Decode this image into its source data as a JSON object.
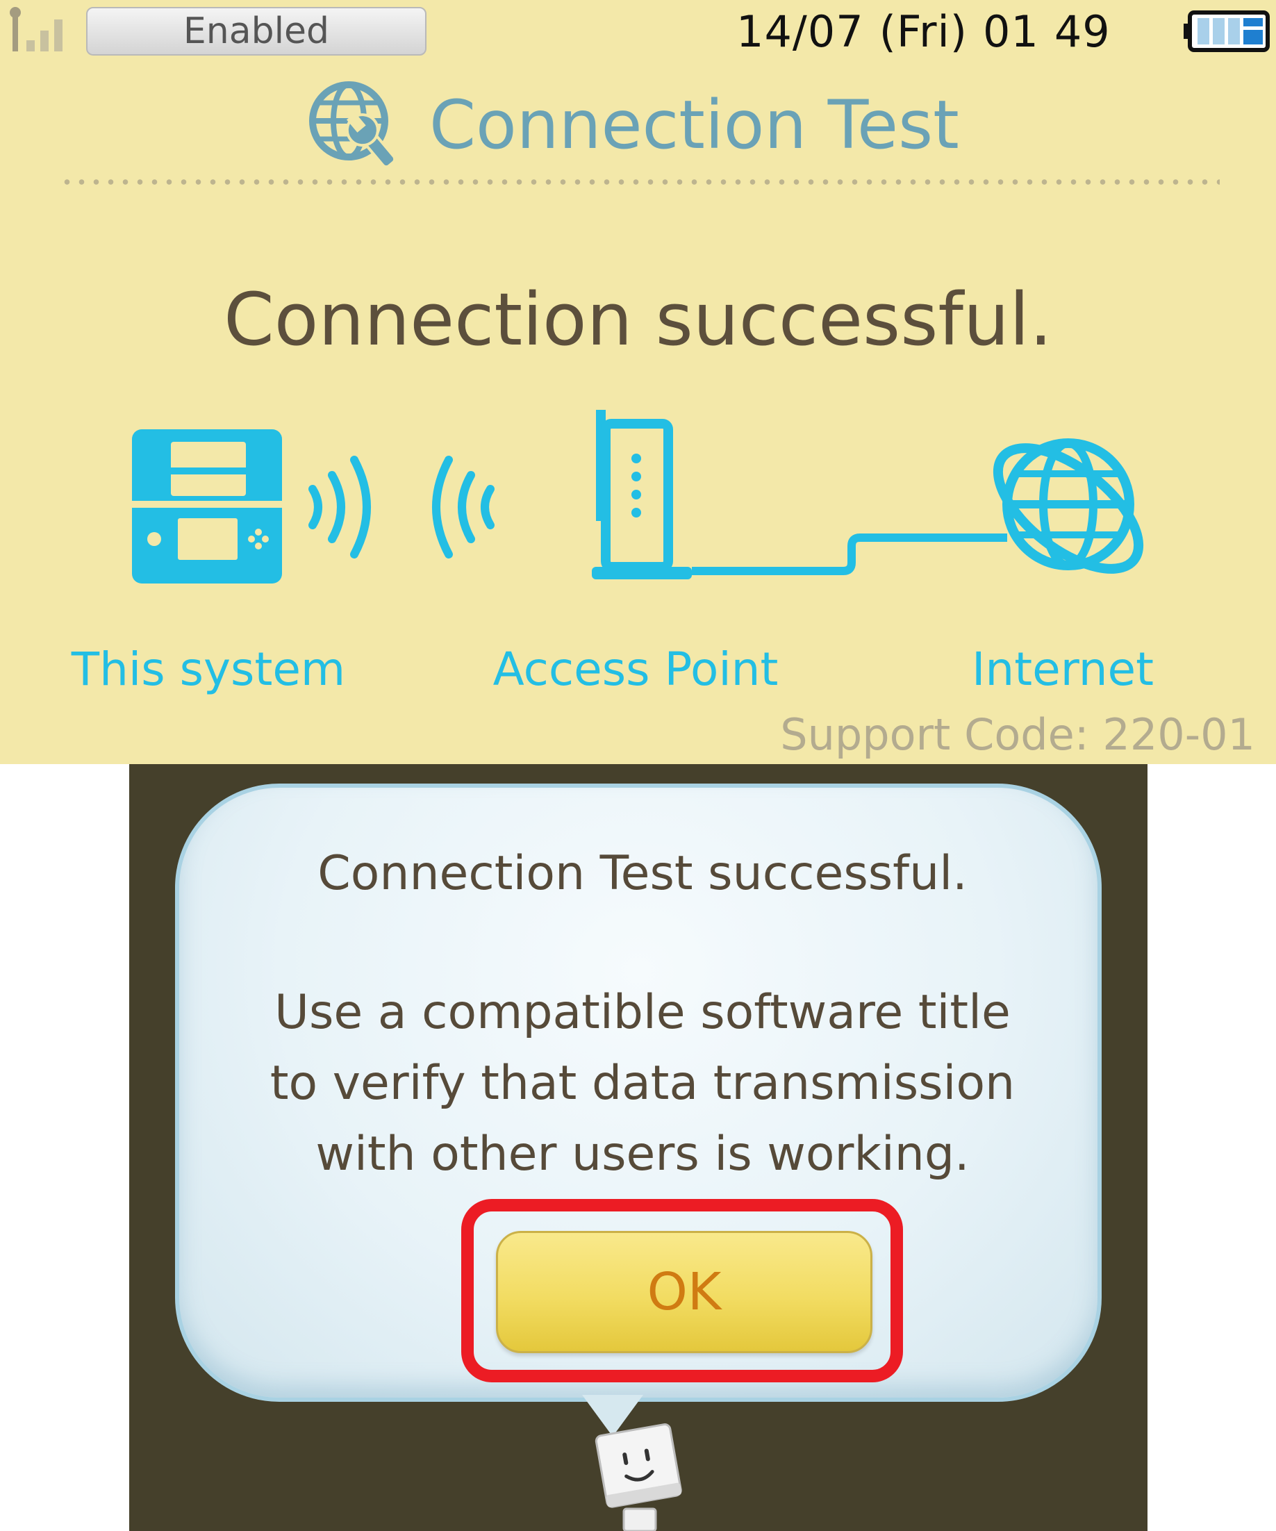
{
  "status_bar": {
    "wireless_status": "Enabled",
    "date": "14/07",
    "weekday": "(Fri)",
    "hour": "01",
    "minute": "49"
  },
  "header": {
    "title": "Connection Test"
  },
  "result": {
    "heading": "Connection successful."
  },
  "diagram": {
    "labels": [
      "This system",
      "Access Point",
      "Internet"
    ]
  },
  "support_code": "Support Code: 220-01",
  "dialog": {
    "title": "Connection Test successful.",
    "lines": [
      "Use a compatible software title",
      "to verify that data transmission",
      "with other users is working."
    ],
    "ok_label": "OK"
  },
  "colors": {
    "top_background": "#f3e8a9",
    "accent_cyan": "#23bee4",
    "title_blue": "#6aa2b6",
    "bottom_background": "#45402b",
    "highlight_red": "#ec1c24",
    "button_yellow": "#f2dc62"
  },
  "icons": {
    "signal": "signal-strength-icon",
    "battery": "battery-icon",
    "title": "globe-wrench-icon",
    "system": "handheld-console-icon",
    "access_point": "router-icon",
    "internet": "globe-icon",
    "mascot": "helper-mascot-icon"
  }
}
